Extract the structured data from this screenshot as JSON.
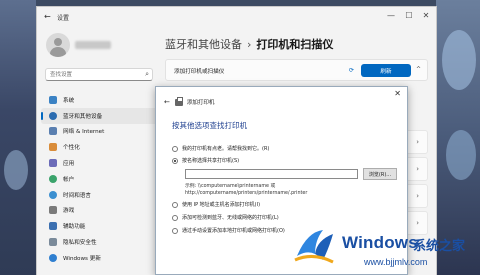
{
  "window": {
    "title": "设置",
    "minimize": "—",
    "maximize": "☐",
    "close": "✕",
    "back": "←"
  },
  "search": {
    "placeholder": "查找设置",
    "value": ""
  },
  "sidebar": {
    "items": [
      {
        "label": "系统",
        "color": "#3b82c4"
      },
      {
        "label": "蓝牙和其他设备",
        "color": "#2b6cb0",
        "active": true
      },
      {
        "label": "网络 & Internet",
        "color": "#5a7fb0"
      },
      {
        "label": "个性化",
        "color": "#d98c3a"
      },
      {
        "label": "应用",
        "color": "#6b6bb8"
      },
      {
        "label": "帐户",
        "color": "#3aa36b"
      },
      {
        "label": "时间和语言",
        "color": "#3b8fd0"
      },
      {
        "label": "游戏",
        "color": "#7a7a7a"
      },
      {
        "label": "辅助功能",
        "color": "#3b6fb0"
      },
      {
        "label": "隐私和安全性",
        "color": "#7a8a9a"
      },
      {
        "label": "Windows 更新",
        "color": "#2f7fd0"
      }
    ]
  },
  "breadcrumb": {
    "parent": "蓝牙和其他设备",
    "separator": "›",
    "current": "打印机和扫描仪"
  },
  "add_printer_card": {
    "label": "添加打印机或扫描仪",
    "refresh_label": "刷新",
    "chevron": "^"
  },
  "bg_cards": {
    "chevron": "›"
  },
  "dialog": {
    "close": "✕",
    "back": "←",
    "title": "添加打印机",
    "heading": "按其他选项查找打印机",
    "options": [
      {
        "label": "我的打印机有点老。请帮我找到它。(R)",
        "selected": false
      },
      {
        "label": "按名称选择共享打印机(S)",
        "selected": true
      },
      {
        "label": "使用 IP 地址或主机名添加打印机(I)",
        "selected": false
      },
      {
        "label": "添加可检测到蓝牙、无线或网络的打印机(L)",
        "selected": false
      },
      {
        "label": "通过手动设置添加本地打印机或网络打印机(O)",
        "selected": false
      }
    ],
    "share_value": "",
    "browse_label": "浏览(R)...",
    "example_line1": "示例: \\\\computername\\printername 或",
    "example_line2": "http://computername/printers/printername/.printer"
  },
  "watermark": {
    "brand": "Windows",
    "cn": "系统之家",
    "url": "www.bjjmlv.com"
  }
}
